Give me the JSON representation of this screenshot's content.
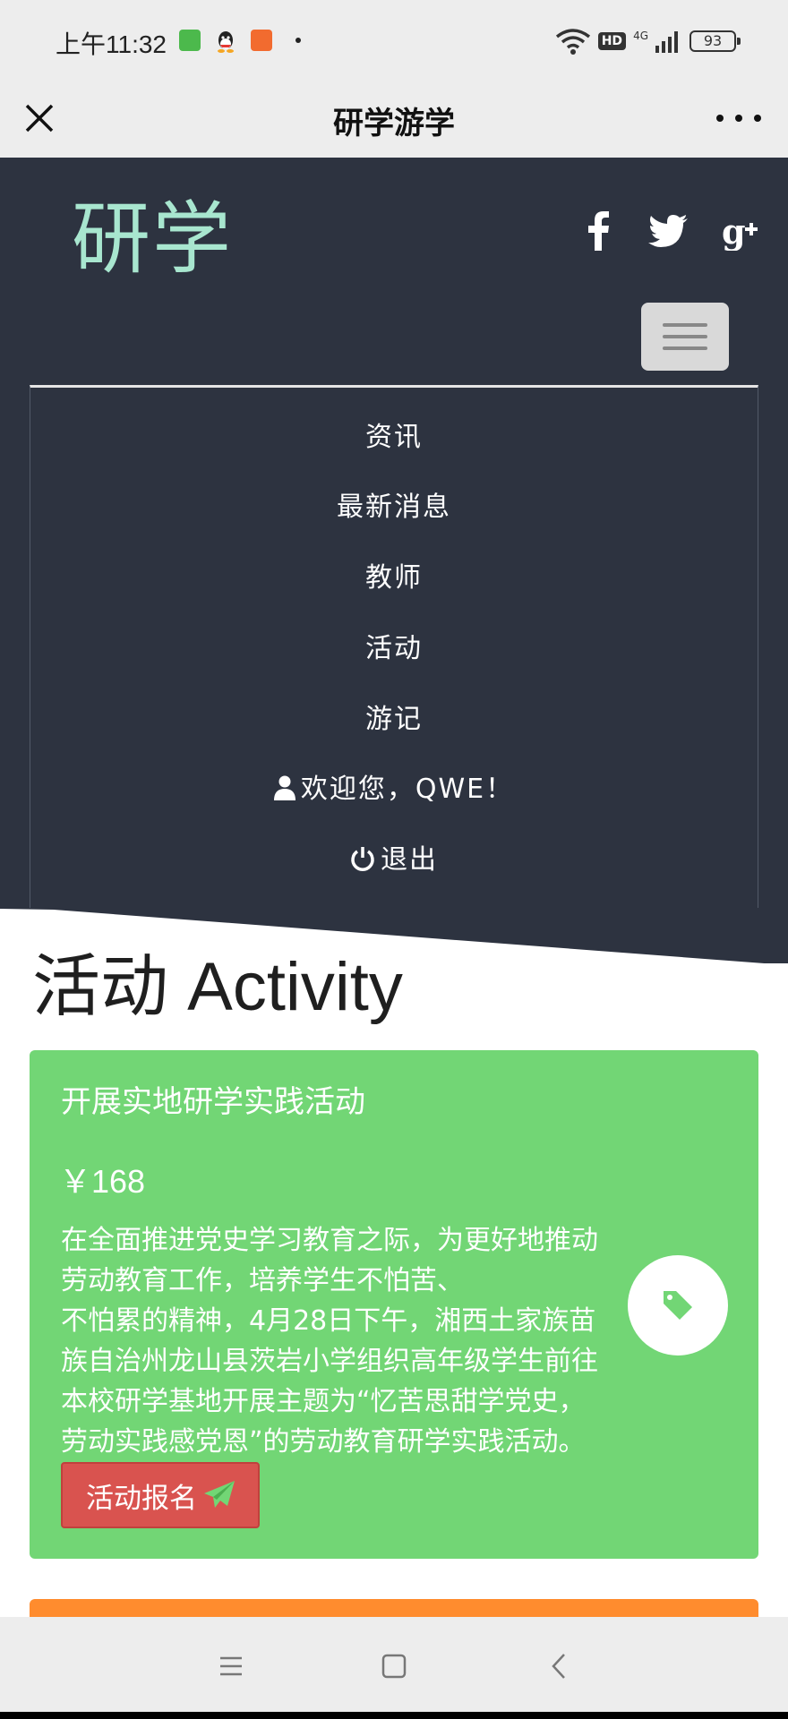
{
  "status_bar": {
    "time": "上午11:32",
    "network_badge": "HD",
    "network_type": "4G",
    "battery": "93",
    "icons": [
      "app-notification-icon",
      "qq-icon",
      "video-app-icon",
      "wifi-icon",
      "signal-icon"
    ]
  },
  "title_bar": {
    "title": "研学游学",
    "close_icon": "close-icon",
    "more_icon": "more-icon"
  },
  "header": {
    "brand": "研学",
    "social_icons": [
      "facebook-icon",
      "twitter-icon",
      "google-plus-icon"
    ],
    "menu_icon": "hamburger-menu-icon",
    "menu": [
      "资讯",
      "最新消息",
      "教师",
      "活动",
      "游记"
    ],
    "welcome": "欢迎您，QWE！",
    "logout": "退出"
  },
  "section": {
    "title_cn": "活动",
    "title_en": "Activity"
  },
  "activity_card": {
    "title": "开展实地研学实践活动",
    "price": "￥168",
    "description_lines": [
      "在全面推进党史学习教育之际，为更好地推动",
      "劳动教育工作，培养学生不怕苦、",
      "不怕累的精神，4月28日下午，湘西土家族苗",
      "族自治州龙山县茨岩小学组织高年级学生前往",
      "本校研学基地开展主题为“忆苦思甜学党史，",
      "劳动实践感党恩”的劳动教育研学实践活动。"
    ],
    "signup_label": "活动报名",
    "colors": {
      "card": "#72d675",
      "button": "#d9534f",
      "next_card": "#ff8c2e"
    }
  },
  "colors": {
    "header_bg": "#2d3340",
    "brand": "#a8e6cf",
    "bars": "#ededed"
  },
  "nav_bar": {
    "buttons": [
      "menu-nav-icon",
      "home-nav-icon",
      "back-nav-icon"
    ]
  }
}
